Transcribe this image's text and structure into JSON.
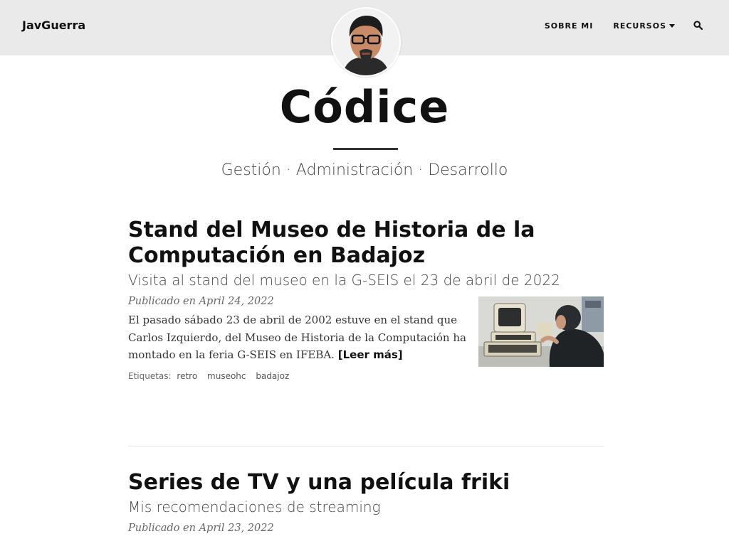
{
  "navbar": {
    "brand": "JavGuerra",
    "links": [
      {
        "label": "SOBRE MI"
      },
      {
        "label": "RECURSOS"
      }
    ],
    "search_icon": "search-icon"
  },
  "header": {
    "avatar_icon": "avatar-photo",
    "title": "Códice",
    "subtitle": "Gestión · Administración · Desarrollo"
  },
  "posts": [
    {
      "title": "Stand del Museo de Historia de la Computación en Badajoz",
      "subtitle": "Visita al stand del museo en la G-SEIS el 23 de abril de 2022",
      "meta": "Publicado en April 24, 2022",
      "excerpt": "El pasado sábado 23 de abril de 2002 estuve en el stand que Carlos Izquierdo, del Museo de Historia de la Computación ha montado en la feria G-SEIS en IFEBA.",
      "read_more": "[Leer más]",
      "tags_label": "Etiquetas:",
      "tags": [
        "retro",
        "museohc",
        "badajoz"
      ],
      "image_icon": "retro-computer-photo"
    },
    {
      "title": "Series de TV y una película friki",
      "subtitle": "Mis recomendaciones de streaming",
      "meta": "Publicado en April 23, 2022"
    }
  ],
  "colors": {
    "navbar_bg": "#eaeaea",
    "text": "#111111",
    "muted": "#666666"
  }
}
